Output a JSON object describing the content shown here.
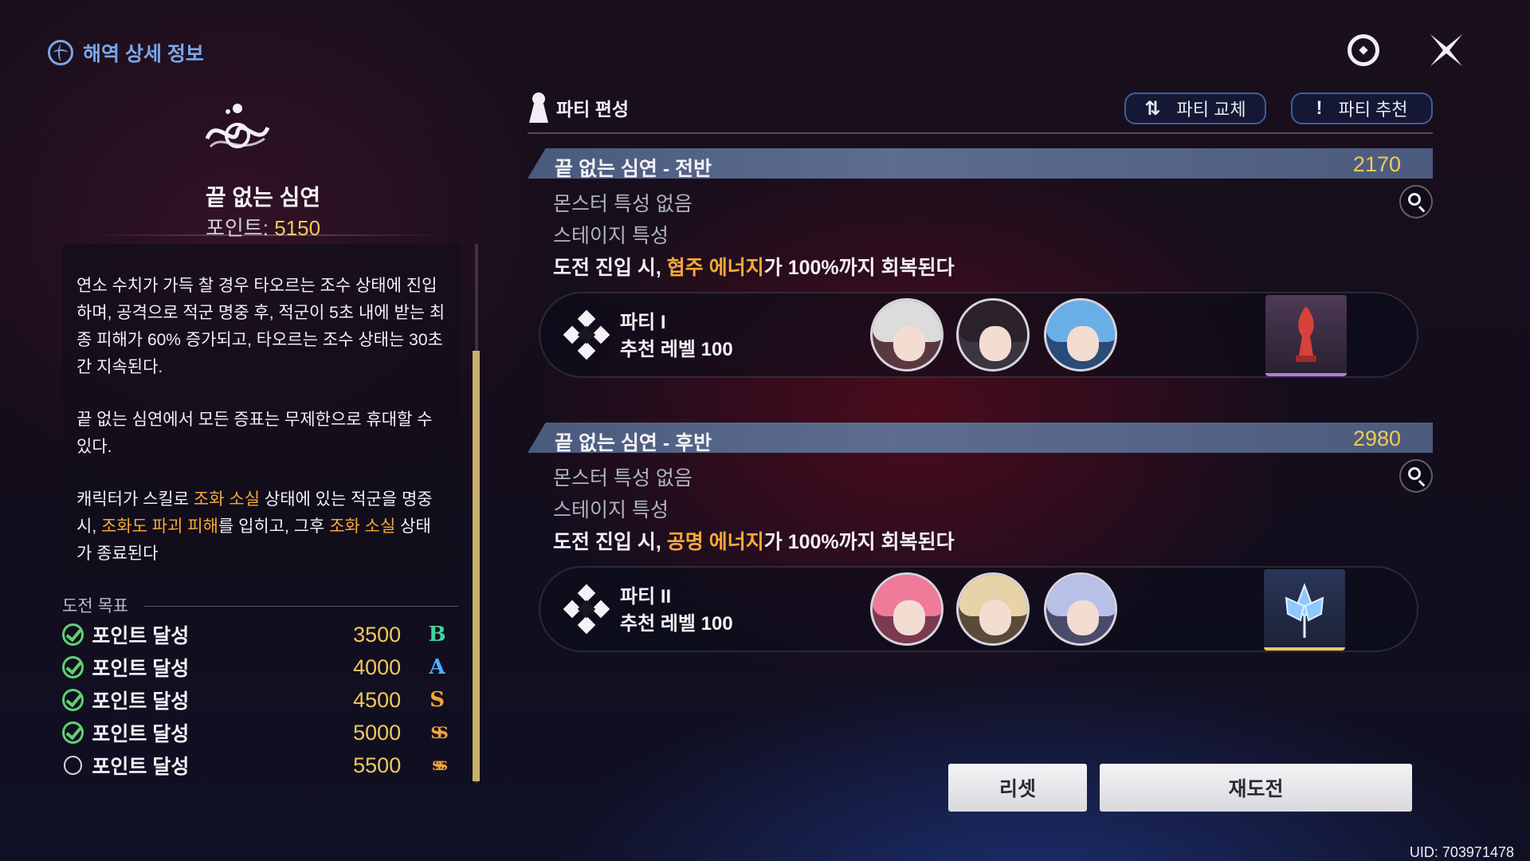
{
  "header": {
    "title": "해역 상세 정보",
    "icons": [
      "sea-globe-icon",
      "hub-icon",
      "close-icon"
    ]
  },
  "zone": {
    "name": "끝 없는 심연",
    "points_label": "포인트:",
    "points_value": "5150"
  },
  "description": {
    "p1": "연소 수치가 가득 찰 경우 타오르는 조수 상태에 진입하며, 공격으로 적군 명중 후, 적군이 5초 내에 받는 최종 피해가 60% 증가되고, 타오르는 조수 상태는 30초간 지속된다.",
    "p2": "끝 없는 심연에서 모든 증표는 무제한으로 휴대할 수 있다.",
    "p3_a": "캐릭터가 스킬로 ",
    "p3_hl1": "조화 소실",
    "p3_b": " 상태에 있는 적군을 명중 시, ",
    "p3_hl2": "조화도 파괴 피해",
    "p3_c": "를 입히고, 그후 ",
    "p3_hl3": "조화 소실",
    "p3_d": " 상태가 종료된다"
  },
  "goals": {
    "heading": "도전 목표",
    "items": [
      {
        "label": "포인트 달성",
        "value": "3500",
        "rank": "B",
        "done": true,
        "color": "#3fd49a"
      },
      {
        "label": "포인트 달성",
        "value": "4000",
        "rank": "A",
        "done": true,
        "color": "#4fb0ff"
      },
      {
        "label": "포인트 달성",
        "value": "4500",
        "rank": "S",
        "done": true,
        "color": "#f2a33a"
      },
      {
        "label": "포인트 달성",
        "value": "5000",
        "rank": "SS",
        "done": true,
        "color": "#f2a33a"
      },
      {
        "label": "포인트 달성",
        "value": "5500",
        "rank": "SSS",
        "done": false,
        "color": "#f2a33a"
      }
    ]
  },
  "party": {
    "heading": "파티 편성",
    "swap_label": "파티 교체",
    "swap_icon": "⇅",
    "recommend_label": "파티 추천",
    "recommend_icon": "!"
  },
  "stages": [
    {
      "title": "끝 없는 심연 - 전반",
      "score": "2170",
      "monster": "몬스터 특성 없음",
      "stage_trait": "스테이지 특성",
      "effect_a": "도전 진입 시, ",
      "effect_hl": "협주 에너지",
      "effect_b": "가 100%까지 회복된다",
      "party_name": "파티 I",
      "party_level": "추천 레벨 100"
    },
    {
      "title": "끝 없는 심연 - 후반",
      "score": "2980",
      "monster": "몬스터 특성 없음",
      "stage_trait": "스테이지 특성",
      "effect_a": "도전 진입 시, ",
      "effect_hl": "공명 에너지",
      "effect_b": "가 100%까지 회복된다",
      "party_name": "파티 II",
      "party_level": "추천 레벨 100"
    }
  ],
  "buttons": {
    "reset": "리셋",
    "retry": "재도전"
  },
  "uid": "UID: 703971478",
  "colors": {
    "accent_gold": "#f1c85a",
    "highlight_orange": "#f3a93a",
    "title_blue": "#7aa6e6"
  }
}
